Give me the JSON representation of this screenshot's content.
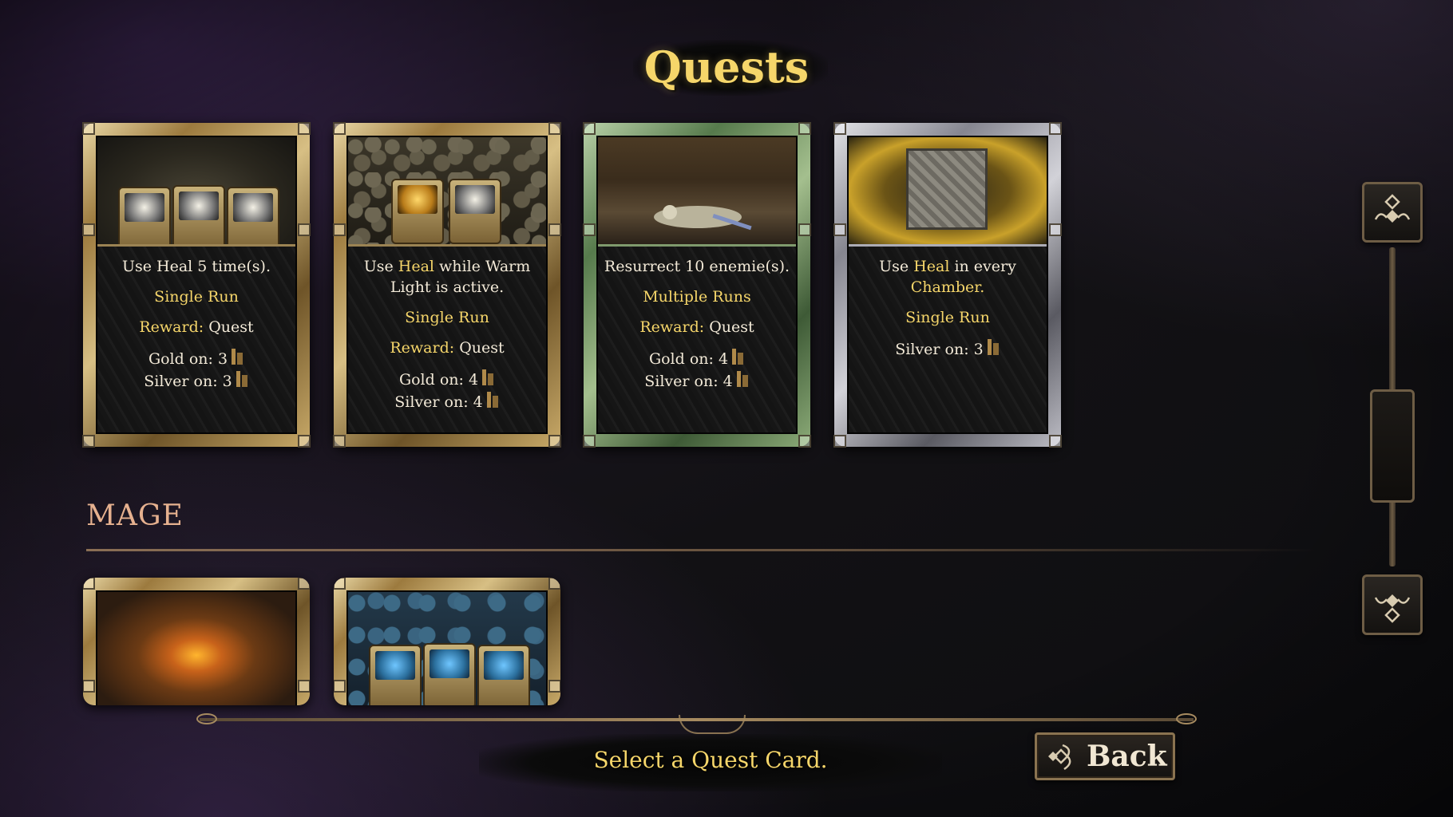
{
  "screen": {
    "title": "Quests",
    "prompt": "Select a Quest Card.",
    "back_label": "Back"
  },
  "colors": {
    "accent_gold_text": "#f6d66a",
    "section_title": "#e6b18f"
  },
  "quest_cards": [
    {
      "frame": "gold",
      "description": [
        "Use Heal 5 time(s)."
      ],
      "run_type": "Single Run",
      "reward_label": "Reward:",
      "reward_value": "Quest",
      "gold_label": "Gold on:",
      "gold_value": "3",
      "silver_label": "Silver on:",
      "silver_value": "3"
    },
    {
      "frame": "gold",
      "description_parts": {
        "pre": "Use ",
        "hl": "Heal",
        "mid": " while Warm",
        "line2": "Light is active."
      },
      "run_type": "Single Run",
      "reward_label": "Reward:",
      "reward_value": "Quest",
      "gold_label": "Gold on:",
      "gold_value": "4",
      "silver_label": "Silver on:",
      "silver_value": "4"
    },
    {
      "frame": "green",
      "description": [
        "Resurrect 10 enemie(s)."
      ],
      "run_type": "Multiple Runs",
      "reward_label": "Reward:",
      "reward_value": "Quest",
      "gold_label": "Gold on:",
      "gold_value": "4",
      "silver_label": "Silver on:",
      "silver_value": "4"
    },
    {
      "frame": "silver",
      "description_parts": {
        "pre": "Use ",
        "hl": "Heal",
        "mid": " in every",
        "line2": "Chamber."
      },
      "run_type": "Single Run",
      "silver_label": "Silver on:",
      "silver_value": "3"
    }
  ],
  "section": {
    "name": "MAGE"
  },
  "icons": {
    "medal": "medal-icon",
    "scroll_up": "diamond-scroll-up-icon",
    "scroll_down": "diamond-scroll-down-icon",
    "back": "diamond-back-icon"
  }
}
